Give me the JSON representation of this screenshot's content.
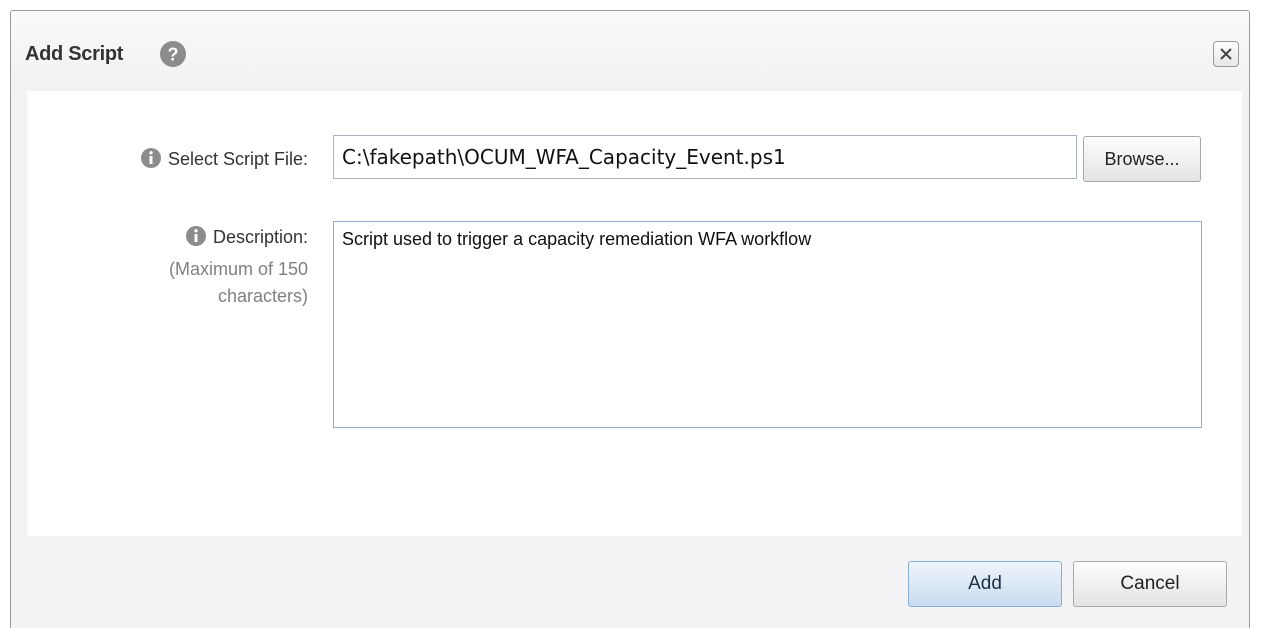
{
  "dialog": {
    "title": "Add Script",
    "help_icon": "question-circle-icon",
    "close_icon": "close-x-icon"
  },
  "form": {
    "script_file": {
      "label": "Select Script File:",
      "info_icon": "info-circle-icon",
      "value": "C:\\fakepath\\OCUM_WFA_Capacity_Event.ps1",
      "browse_label": "Browse..."
    },
    "description": {
      "label": "Description:",
      "info_icon": "info-circle-icon",
      "hint_line1": "(Maximum of 150",
      "hint_line2": "characters)",
      "value": "Script used to trigger a capacity remediation WFA workflow"
    }
  },
  "footer": {
    "add_label": "Add",
    "cancel_label": "Cancel"
  },
  "colors": {
    "dialog_bg": "#f3f2f5",
    "content_bg": "#ffffff",
    "icon_gray": "#8c8c8c",
    "add_button_bg": "#c9dcef",
    "focus_border": "#8fb0d5"
  }
}
